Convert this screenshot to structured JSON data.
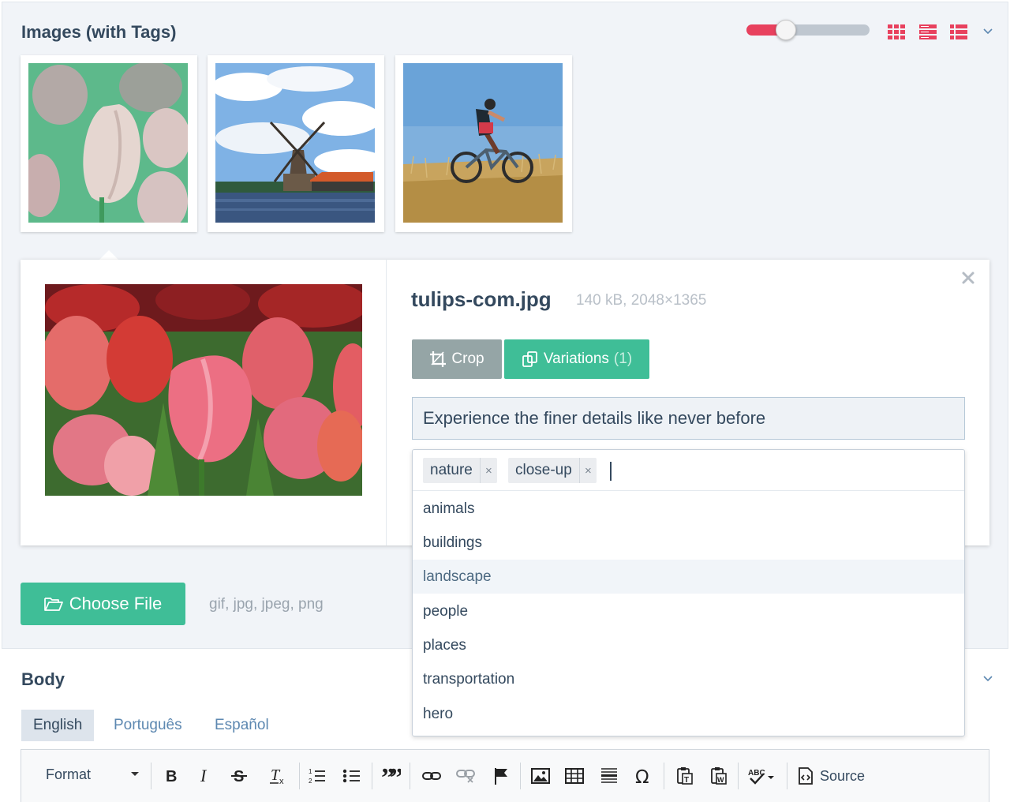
{
  "images_section": {
    "title": "Images (with Tags)",
    "zoom_slider_value_percent": 31,
    "view_modes": [
      {
        "name": "grid-view-icon"
      },
      {
        "name": "list-view-icon"
      },
      {
        "name": "detail-list-view-icon"
      }
    ],
    "thumbnails": [
      {
        "subject": "tulips"
      },
      {
        "subject": "windmill"
      },
      {
        "subject": "cyclist"
      }
    ]
  },
  "detail": {
    "filename": "tulips-com.jpg",
    "meta": "140 kB, 2048×1365",
    "crop_label": "Crop",
    "variations_label": "Variations",
    "variations_count": "(1)",
    "caption_value": "Experience the finer details like never before",
    "tags": [
      "nature",
      "close-up"
    ],
    "tag_remove_glyph": "×",
    "suggestions": [
      "animals",
      "buildings",
      "landscape",
      "people",
      "places",
      "transportation",
      "hero"
    ],
    "highlighted_suggestion": "landscape"
  },
  "upload": {
    "choose_label": "Choose File",
    "file_types": "gif, jpg, jpeg, png"
  },
  "body_section": {
    "title": "Body",
    "languages": [
      "English",
      "Português",
      "Español"
    ],
    "active_language": "English",
    "toolbar": {
      "format_label": "Format",
      "source_label": "Source"
    }
  },
  "colors": {
    "accent_red": "#e8415e",
    "accent_green": "#3fbe97",
    "gray_button": "#95a5a6",
    "heading": "#34495e"
  }
}
